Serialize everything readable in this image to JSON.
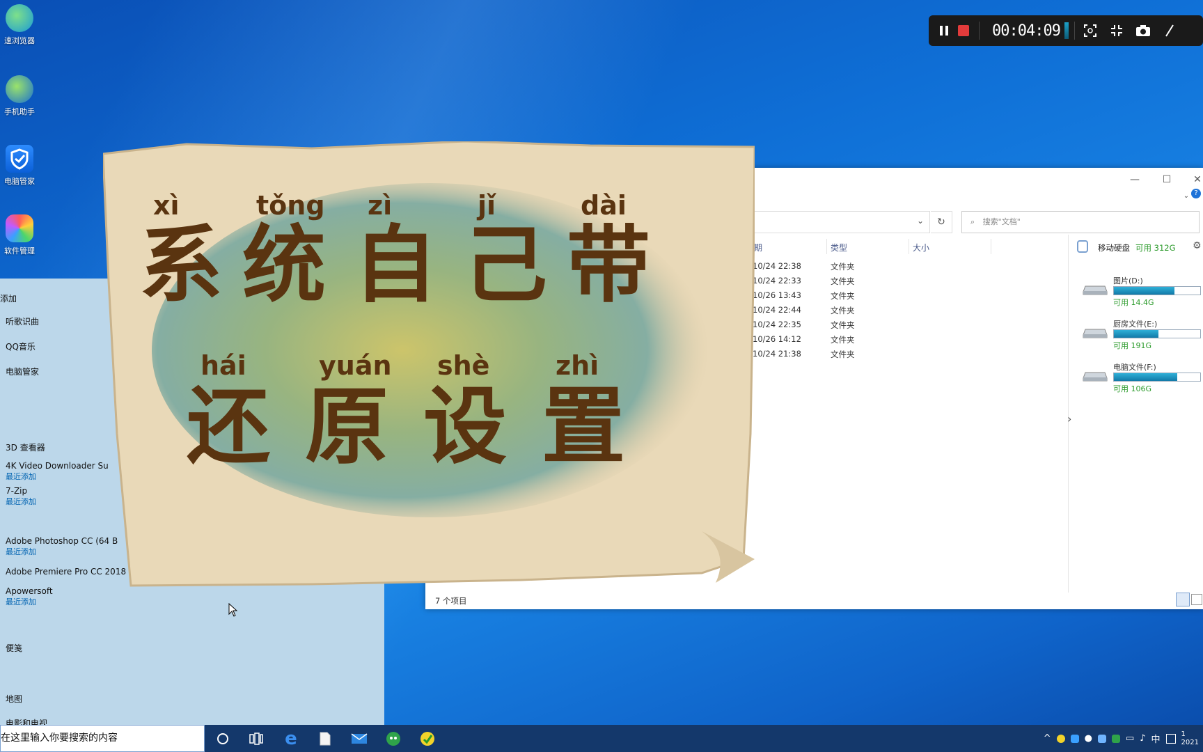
{
  "desktop_icons": [
    {
      "name": "browser-icon",
      "label": "速浏览器"
    },
    {
      "name": "phone-assistant-icon",
      "label": "手机助手"
    },
    {
      "name": "pc-manager-icon",
      "label": "电脑管家"
    },
    {
      "name": "software-manager-icon",
      "label": "软件管理"
    }
  ],
  "recorder": {
    "time": "00:04:09"
  },
  "start_menu": {
    "items": [
      {
        "label": "添加",
        "sub": ""
      },
      {
        "label": "听歌识曲",
        "sub": ""
      },
      {
        "label": "QQ音乐",
        "sub": ""
      },
      {
        "label": "电脑管家",
        "sub": ""
      },
      {
        "label": "3D 查看器",
        "sub": ""
      },
      {
        "label": "4K Video Downloader Su",
        "sub": "最近添加"
      },
      {
        "label": "7-Zip",
        "sub": "最近添加"
      },
      {
        "label": "Adobe Photoshop CC (64 B",
        "sub": "最近添加"
      },
      {
        "label": "Adobe Premiere Pro CC 2018",
        "sub": ""
      },
      {
        "label": "Apowersoft",
        "sub": "最近添加"
      },
      {
        "label": "便笺",
        "sub": ""
      },
      {
        "label": "地图",
        "sub": ""
      },
      {
        "label": "电影和电视",
        "sub": ""
      }
    ]
  },
  "explorer": {
    "search_placeholder": "搜索\"文档\"",
    "columns": {
      "date": "期",
      "type": "类型",
      "size": "大小"
    },
    "rows": [
      {
        "date": "10/24 22:38",
        "type": "文件夹"
      },
      {
        "date": "10/24 22:33",
        "type": "文件夹"
      },
      {
        "date": "10/26 13:43",
        "type": "文件夹"
      },
      {
        "date": "10/24 22:44",
        "type": "文件夹"
      },
      {
        "date": "10/24 22:35",
        "type": "文件夹"
      },
      {
        "date": "10/26 14:12",
        "type": "文件夹"
      },
      {
        "date": "10/24 21:38",
        "type": "文件夹"
      }
    ],
    "status": "7 个项目",
    "panel": {
      "title": "移动硬盘",
      "free_label": "可用 312G",
      "drives": [
        {
          "name": "图片(D:)",
          "free": "可用 14.4G",
          "used_fraction": 0.7
        },
        {
          "name": "厨房文件(E:)",
          "free": "可用 191G",
          "used_fraction": 0.52
        },
        {
          "name": "电脑文件(F:)",
          "free": "可用 106G",
          "used_fraction": 0.73
        }
      ]
    }
  },
  "overlay": {
    "line1": [
      {
        "pinyin": "xì",
        "hanzi": "系"
      },
      {
        "pinyin": "tǒng",
        "hanzi": "统"
      },
      {
        "pinyin": "zì",
        "hanzi": "自"
      },
      {
        "pinyin": "jǐ",
        "hanzi": "己"
      },
      {
        "pinyin": "dài",
        "hanzi": "带"
      }
    ],
    "line2": [
      {
        "pinyin": "hái",
        "hanzi": "还"
      },
      {
        "pinyin": "yuán",
        "hanzi": "原"
      },
      {
        "pinyin": "shè",
        "hanzi": "设"
      },
      {
        "pinyin": "zhì",
        "hanzi": "置"
      }
    ]
  },
  "taskbar": {
    "search_text": "在这里输入你要搜索的内容",
    "ime": "中",
    "clock_time": "1",
    "clock_date": "2021"
  }
}
